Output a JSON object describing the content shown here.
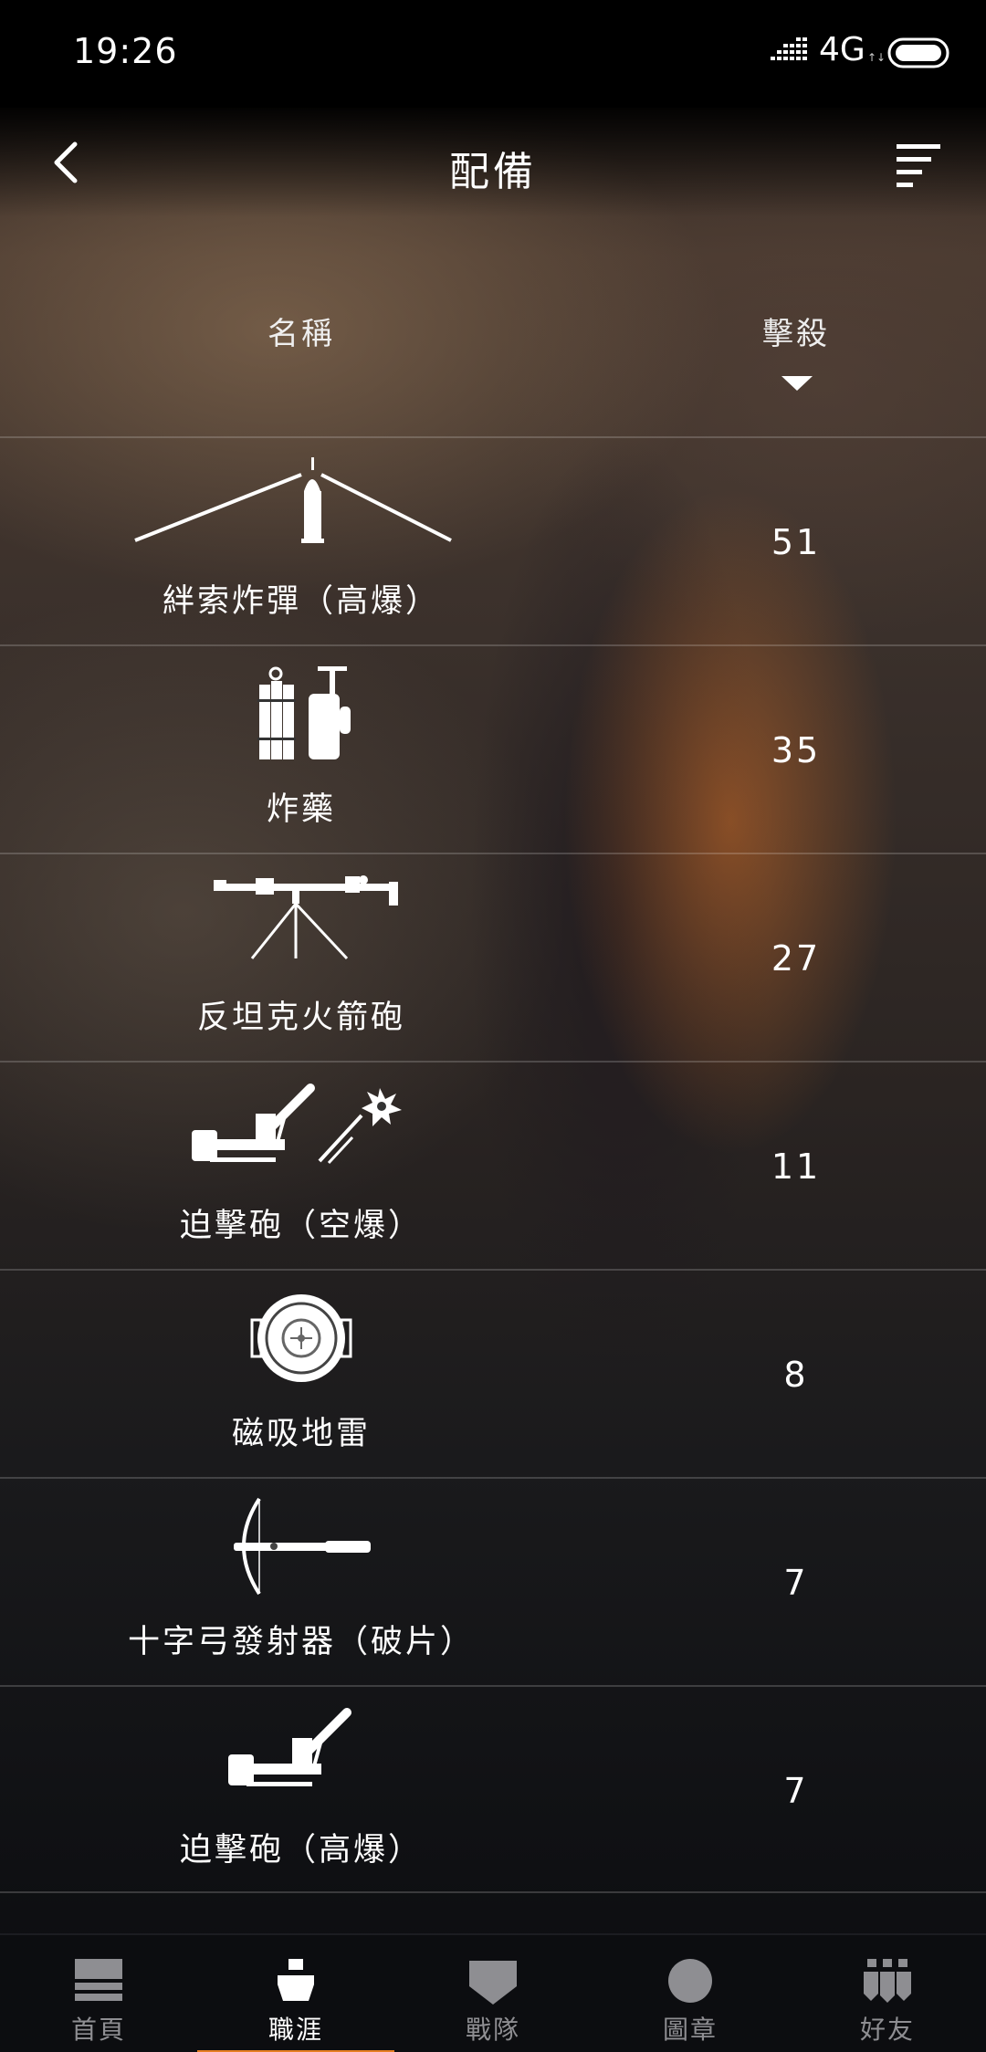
{
  "status_bar": {
    "time": "19:26",
    "network": "4G",
    "network_arrows": "↑↓"
  },
  "header": {
    "title": "配備",
    "back_icon": "chevron-left-icon",
    "filter_icon": "filter-sort-icon"
  },
  "columns": {
    "name": "名稱",
    "kills": "擊殺"
  },
  "items": [
    {
      "name": "絆索炸彈（高爆）",
      "kills": "51",
      "icon": "tripwire-bomb-icon"
    },
    {
      "name": "炸藥",
      "kills": "35",
      "icon": "dynamite-icon"
    },
    {
      "name": "反坦克火箭砲",
      "kills": "27",
      "icon": "at-rocket-gun-icon"
    },
    {
      "name": "迫擊砲（空爆）",
      "kills": "11",
      "icon": "mortar-airburst-icon"
    },
    {
      "name": "磁吸地雷",
      "kills": "8",
      "icon": "limpet-mine-icon"
    },
    {
      "name": "十字弓發射器（破片）",
      "kills": "7",
      "icon": "crossbow-icon"
    },
    {
      "name": "迫擊砲（高爆）",
      "kills": "7",
      "icon": "mortar-he-icon"
    }
  ],
  "nav": {
    "items": [
      {
        "label": "首頁",
        "icon": "home-icon"
      },
      {
        "label": "職涯",
        "icon": "soldier-icon"
      },
      {
        "label": "戰隊",
        "icon": "shield-icon"
      },
      {
        "label": "圖章",
        "icon": "emblem-icon"
      },
      {
        "label": "好友",
        "icon": "friends-icon"
      }
    ],
    "active_index": 1,
    "accent_color": "#e67e22"
  }
}
